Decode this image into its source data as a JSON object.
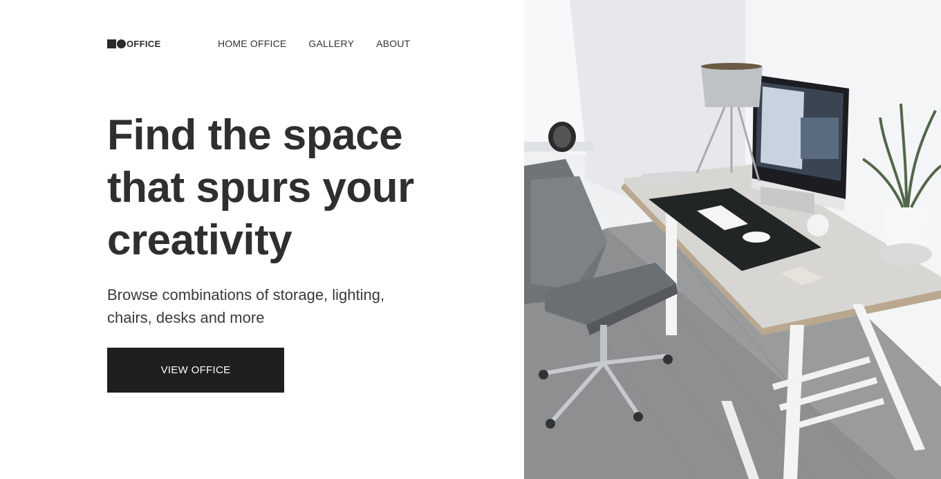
{
  "brand": {
    "name": "OFFICE",
    "logo_icon": "square-circle-logo",
    "color": "#2b2b2b"
  },
  "nav": {
    "items": [
      "HOME OFFICE",
      "GALLERY",
      "ABOUT"
    ]
  },
  "hero": {
    "title_lines": [
      "Find the space",
      "that spurs your",
      "creativity"
    ],
    "subtitle": "Browse combinations of storage, lighting, chairs, desks and more",
    "cta_label": "VIEW OFFICE",
    "cta_color": "#1f1f1f"
  },
  "image": {
    "subject": "home-office-photo"
  }
}
